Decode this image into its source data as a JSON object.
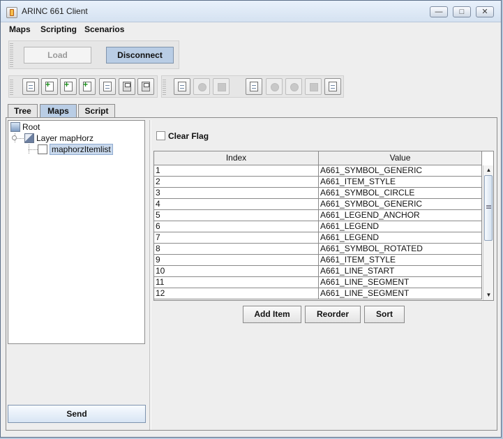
{
  "window": {
    "title": "ARINC 661 Client",
    "minimize": "—",
    "maximize": "□",
    "close": "✕"
  },
  "menus": [
    "Maps",
    "Scripting",
    "Scenarios"
  ],
  "connection": {
    "load_label": "Load",
    "disconnect_label": "Disconnect"
  },
  "tabs": [
    "Tree",
    "Maps",
    "Script"
  ],
  "active_tab": "Maps",
  "tree": {
    "root": "Root",
    "layer": "Layer mapHorz",
    "item": "maphorzItemlist"
  },
  "send_label": "Send",
  "clear_flag_label": "Clear Flag",
  "table": {
    "headers": [
      "Index",
      "Value"
    ],
    "rows": [
      {
        "index": "1",
        "value": "A661_SYMBOL_GENERIC"
      },
      {
        "index": "2",
        "value": "A661_ITEM_STYLE"
      },
      {
        "index": "3",
        "value": "A661_SYMBOL_CIRCLE"
      },
      {
        "index": "4",
        "value": "A661_SYMBOL_GENERIC"
      },
      {
        "index": "5",
        "value": "A661_LEGEND_ANCHOR"
      },
      {
        "index": "6",
        "value": "A661_LEGEND"
      },
      {
        "index": "7",
        "value": "A661_LEGEND"
      },
      {
        "index": "8",
        "value": "A661_SYMBOL_ROTATED"
      },
      {
        "index": "9",
        "value": "A661_ITEM_STYLE"
      },
      {
        "index": "10",
        "value": "A661_LINE_START"
      },
      {
        "index": "11",
        "value": "A661_LINE_SEGMENT"
      },
      {
        "index": "12",
        "value": "A661_LINE_SEGMENT"
      }
    ]
  },
  "actions": {
    "add_item": "Add Item",
    "reorder": "Reorder",
    "sort": "Sort"
  },
  "colors": {
    "accent": "#b9cde5",
    "window_bg": "#eeeeee",
    "title_bg": "#dce8f5"
  }
}
